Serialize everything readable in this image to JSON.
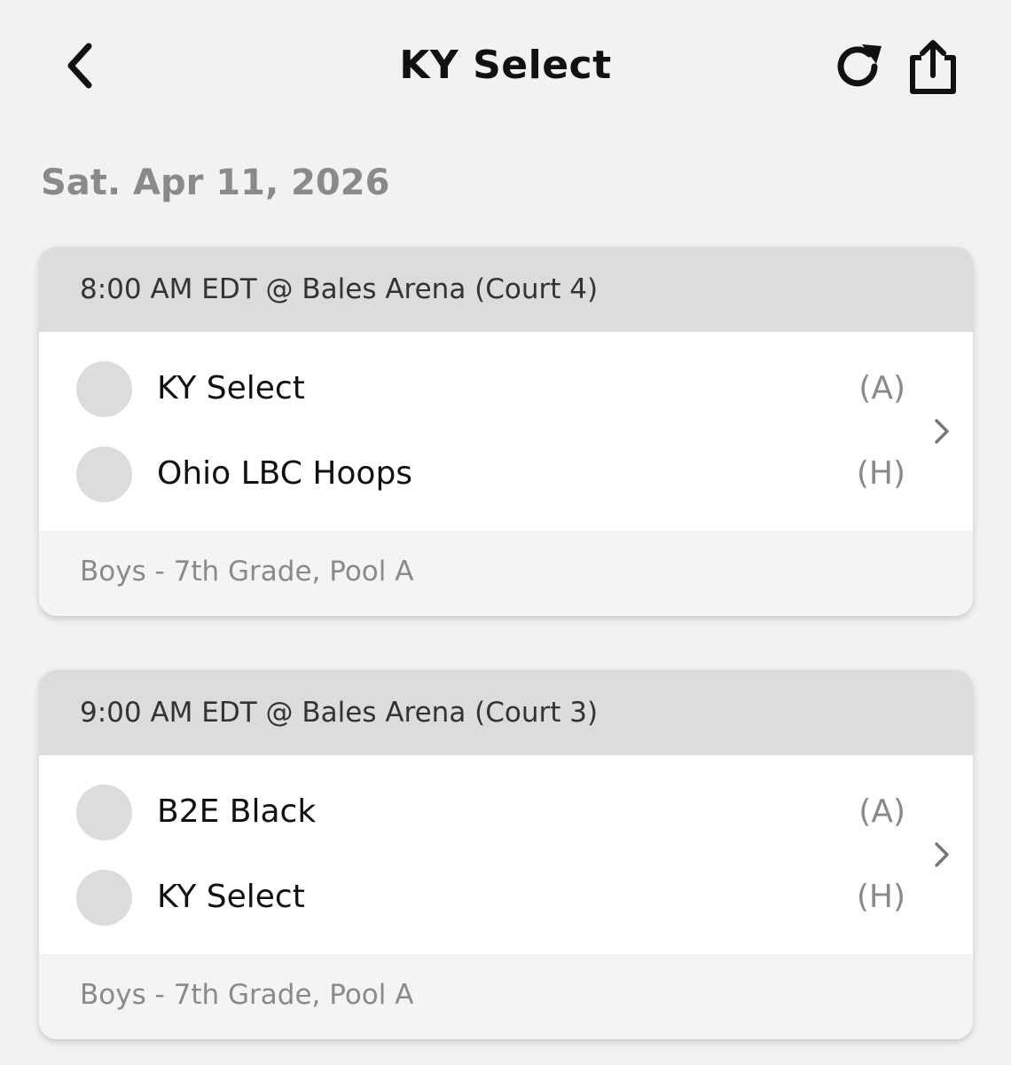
{
  "header": {
    "title": "KY Select",
    "back_icon": "chevron-left-icon",
    "refresh_icon": "refresh-icon",
    "share_icon": "share-icon"
  },
  "schedule": {
    "date": "Sat. Apr 11, 2026",
    "games": [
      {
        "time_location": "8:00 AM EDT @ Bales Arena (Court 4)",
        "teams": [
          {
            "name": "KY Select",
            "side": "(A)"
          },
          {
            "name": "Ohio LBC Hoops",
            "side": "(H)"
          }
        ],
        "division": "Boys - 7th Grade, Pool A"
      },
      {
        "time_location": "9:00 AM EDT @ Bales Arena (Court 3)",
        "teams": [
          {
            "name": "B2E Black",
            "side": "(A)"
          },
          {
            "name": "KY Select",
            "side": "(H)"
          }
        ],
        "division": "Boys - 7th Grade, Pool A"
      }
    ]
  },
  "colors": {
    "background": "#f2f2f4",
    "card_header": "#dcdcdc",
    "muted_text": "#8a8a8c"
  }
}
